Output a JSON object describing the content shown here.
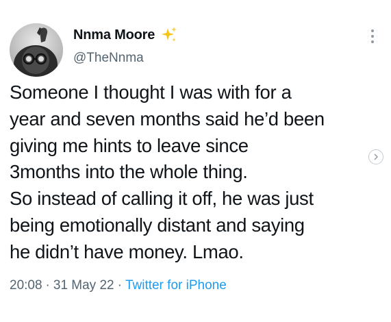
{
  "author": {
    "name": "Nnma Moore",
    "handle": "@TheNnma",
    "badge_icon": "sparkle-icon",
    "badge_color": "#f5c518"
  },
  "tweet": {
    "lines": [
      "Someone I thought I was with for a",
      "year and seven months said he’d been",
      "giving me hints to leave since",
      "3months into the whole thing.",
      "So instead of calling it off, he was just",
      "being emotionally distant and saying",
      "he didn’t have money. Lmao."
    ]
  },
  "meta": {
    "time": "20:08",
    "separator": "·",
    "date": "31 May 22",
    "source": "Twitter for iPhone",
    "source_color": "#1d9bf0"
  },
  "icons": {
    "more": "more-dots-icon",
    "next": "chevron-right-icon"
  }
}
